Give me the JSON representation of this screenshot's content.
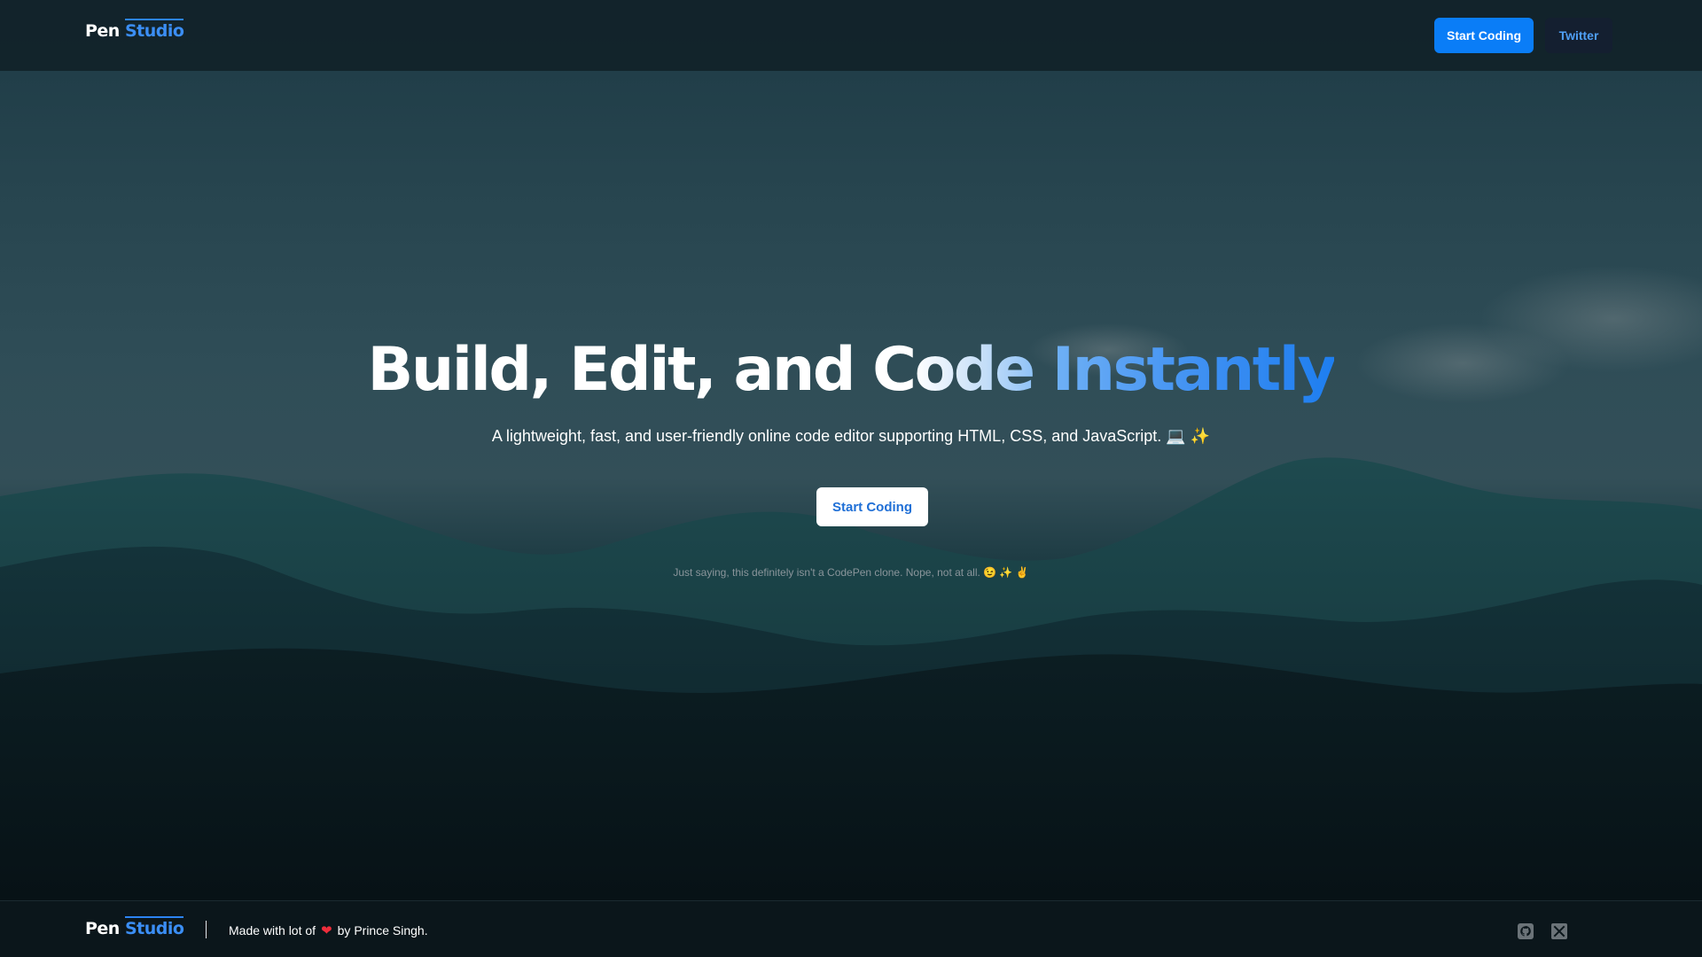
{
  "header": {
    "logo": {
      "part1": "Pen",
      "part2": "Studio"
    },
    "primary_button": "Start Coding",
    "secondary_button": "Twitter"
  },
  "hero": {
    "title_part1": "Build, Edit, and C",
    "title_fade": "ode",
    "title_highlight": "Instantly",
    "subtitle": "A lightweight, fast, and user-friendly online code editor supporting HTML, CSS, and JavaScript. 💻 ✨",
    "cta_button": "Start Coding",
    "note": "Just saying, this definitely isn't a CodePen clone. Nope, not at all. 😉 ✨ ✌️"
  },
  "footer": {
    "logo": {
      "part1": "Pen",
      "part2": "Studio"
    },
    "made_with": "Made with lot of",
    "heart": "❤",
    "by": "by Prince Singh.",
    "social_icons": [
      "github-icon",
      "x-icon"
    ]
  },
  "colors": {
    "accent": "#0a7df7",
    "brand_blue": "#3b8ef5",
    "heart": "#ef2d3b",
    "header_bg": "#112229",
    "footer_bg": "#0b161b"
  }
}
